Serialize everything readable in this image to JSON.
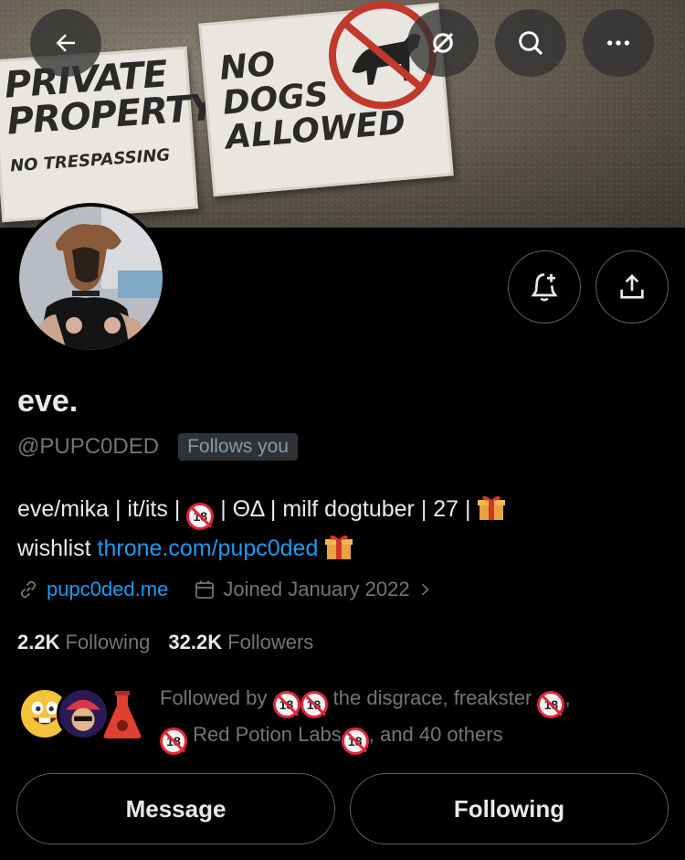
{
  "banner": {
    "sign_private": [
      "PRIVATE",
      "PROPERTY",
      "NO TRESPASSING"
    ],
    "sign_dogs": [
      "NO",
      "DOGS",
      "ALLOWED"
    ]
  },
  "header_icons": {
    "back": "arrow-left-icon",
    "grok": "grok-icon",
    "search": "search-icon",
    "more": "more-icon"
  },
  "profile": {
    "name": "eve.",
    "handle": "@PUPC0DED",
    "follows_you": "Follows you",
    "bio_line1_a": "eve/mika | it/its |",
    "bio_line1_b": "| ΘΔ | milf dogtuber | 27 |",
    "bio_line2_a": "wishlist",
    "bio_link": "throne.com/pupc0ded",
    "website": "pupc0ded.me",
    "joined": "Joined January 2022",
    "following_count": "2.2K",
    "following_label": "Following",
    "followers_count": "32.2K",
    "followers_label": "Followers",
    "followed_by_a": "Followed by",
    "followed_by_b": "the disgrace, freakster",
    "followed_by_c": "Red Potion Labs",
    "followed_by_d": ", and 40 others"
  },
  "buttons": {
    "message": "Message",
    "following": "Following"
  },
  "colors": {
    "background": "#000000",
    "link": "#1d9bf0",
    "muted": "#71767b",
    "border": "#536471"
  }
}
